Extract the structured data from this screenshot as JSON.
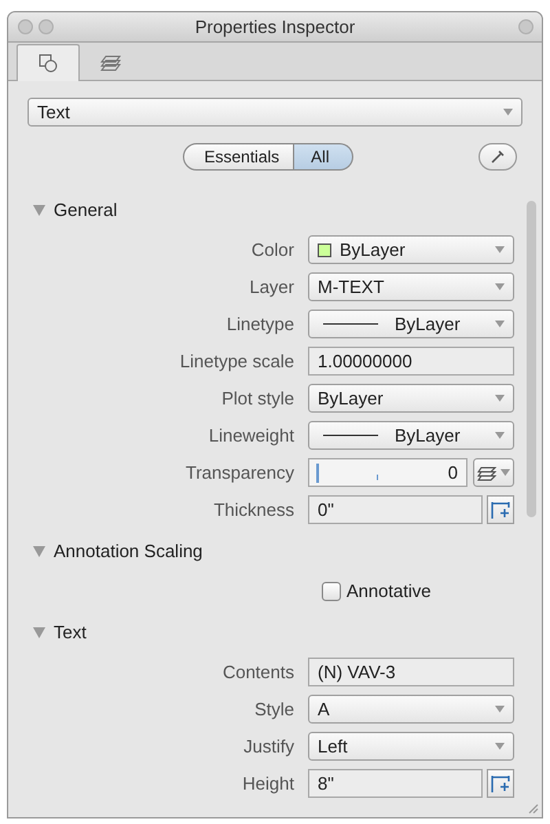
{
  "window": {
    "title": "Properties Inspector"
  },
  "tabs": [
    {
      "kind": "objects",
      "selected": true
    },
    {
      "kind": "layers",
      "selected": false
    }
  ],
  "object_type": {
    "value": "Text"
  },
  "view_toggle": [
    {
      "label": "Essentials",
      "selected": false
    },
    {
      "label": "All",
      "selected": true
    }
  ],
  "sections": [
    {
      "title": "General",
      "expanded": true,
      "rows": [
        {
          "kind": "color_dropdown",
          "label": "Color",
          "value": "ByLayer",
          "color": "#ccff99"
        },
        {
          "kind": "dropdown",
          "label": "Layer",
          "value": "M-TEXT"
        },
        {
          "kind": "line_dropdown",
          "label": "Linetype",
          "value": "ByLayer"
        },
        {
          "kind": "field",
          "label": "Linetype scale",
          "value": "1.00000000"
        },
        {
          "kind": "dropdown",
          "label": "Plot style",
          "value": "ByLayer"
        },
        {
          "kind": "line_dropdown",
          "label": "Lineweight",
          "value": "ByLayer"
        },
        {
          "kind": "slider",
          "label": "Transparency",
          "value": "0",
          "level": 0
        },
        {
          "kind": "pick_field",
          "label": "Thickness",
          "value": "0\""
        }
      ]
    },
    {
      "title": "Annotation Scaling",
      "expanded": true,
      "rows": [
        {
          "kind": "checkbox",
          "label": "Annotative",
          "checked": false
        }
      ]
    },
    {
      "title": "Text",
      "expanded": true,
      "rows": [
        {
          "kind": "field",
          "label": "Contents",
          "value": "(N) VAV-3"
        },
        {
          "kind": "dropdown",
          "label": "Style",
          "value": "A"
        },
        {
          "kind": "dropdown",
          "label": "Justify",
          "value": "Left"
        },
        {
          "kind": "pick_field",
          "label": "Height",
          "value": "8\""
        }
      ]
    }
  ]
}
